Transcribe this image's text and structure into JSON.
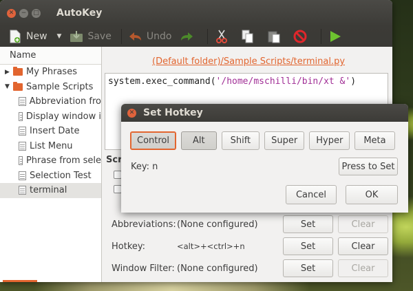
{
  "window": {
    "title": "AutoKey"
  },
  "toolbar": {
    "new_label": "New",
    "save_label": "Save",
    "undo_label": "Undo"
  },
  "sidebar": {
    "header": "Name",
    "folders": [
      {
        "label": "My Phrases"
      },
      {
        "label": "Sample Scripts"
      }
    ],
    "items": [
      {
        "label": "Abbreviation fro"
      },
      {
        "label": "Display window i"
      },
      {
        "label": "Insert Date"
      },
      {
        "label": "List Menu"
      },
      {
        "label": "Phrase from sele"
      },
      {
        "label": "Selection Test"
      },
      {
        "label": "terminal"
      }
    ]
  },
  "main": {
    "path_link": "(Default folder)/Sample Scripts/terminal.py",
    "code_prefix": "system.exec_command(",
    "code_string": "'/home/mschilli/bin/xt &'",
    "code_suffix": ")",
    "section_label": "Scr",
    "settings": [
      {
        "label": "Abbreviations:",
        "value": "(None configured)",
        "set": "Set",
        "clear": "Clear"
      },
      {
        "label": "Hotkey:",
        "value": "<alt>+<ctrl>+n",
        "set": "Set",
        "clear": "Clear"
      },
      {
        "label": "Window Filter:",
        "value": "(None configured)",
        "set": "Set",
        "clear": "Clear"
      }
    ]
  },
  "dialog": {
    "title": "Set Hotkey",
    "modifiers": [
      "Control",
      "Alt",
      "Shift",
      "Super",
      "Hyper",
      "Meta"
    ],
    "key_label": "Key: n",
    "press_label": "Press to Set",
    "cancel_label": "Cancel",
    "ok_label": "OK"
  },
  "colors": {
    "accent": "#e2652f",
    "titlebar": "#3c3b37",
    "string": "#a12f96"
  }
}
